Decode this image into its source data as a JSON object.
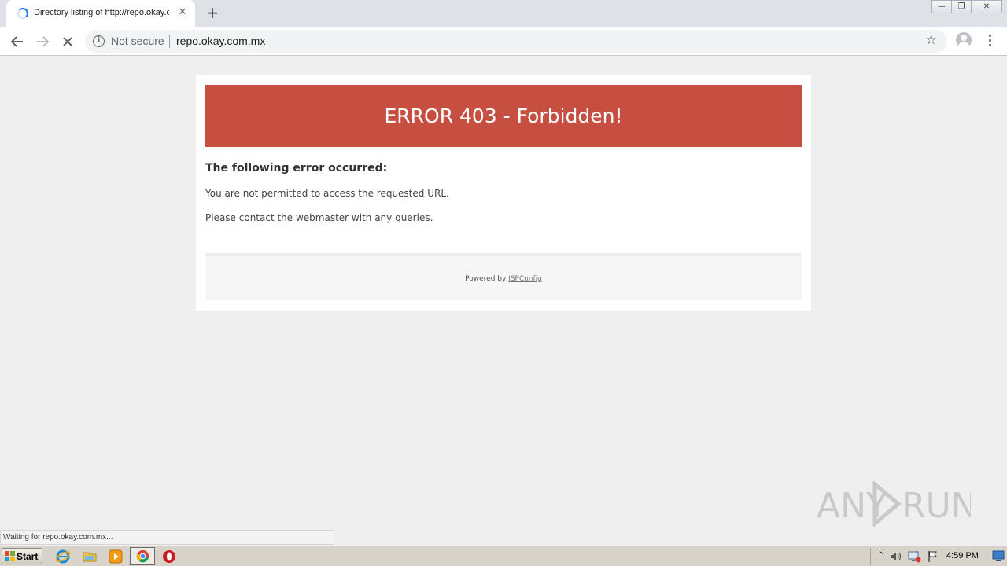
{
  "browser": {
    "tab_title": "Directory listing of http://repo.okay.com.mx/",
    "tab_close": "✕",
    "new_tab": "+",
    "security_label": "Not secure",
    "url": "repo.okay.com.mx",
    "status_text": "Waiting for repo.okay.com.mx...",
    "window_controls": {
      "minimize": "—",
      "maximize": "❐",
      "close": "✕"
    }
  },
  "page": {
    "banner_title": "ERROR 403 - Forbidden!",
    "subheading": "The following error occurred:",
    "message_1": "You are not permitted to access the requested URL.",
    "message_2": "Please contact the webmaster with any queries.",
    "footer_prefix": "Powered by",
    "footer_link": "ISPConfig",
    "banner_color": "#c64f41"
  },
  "watermark": {
    "text": "ANY RUN"
  },
  "taskbar": {
    "start_label": "Start",
    "pinned": [
      "internet-explorer-icon",
      "folder-icon",
      "media-player-icon",
      "chrome-icon",
      "opera-icon"
    ],
    "clock": "4:59 PM"
  }
}
